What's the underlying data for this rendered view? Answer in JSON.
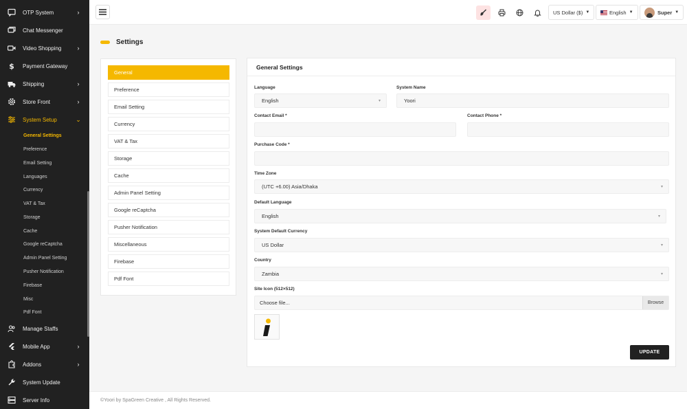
{
  "sidebar": {
    "items": [
      {
        "label": "OTP System",
        "icon": "message-square-icon",
        "chevron": "›"
      },
      {
        "label": "Chat Messenger",
        "icon": "chat-icon",
        "chevron": ""
      },
      {
        "label": "Video Shopping",
        "icon": "video-icon",
        "chevron": "›"
      },
      {
        "label": "Payment Gateway",
        "icon": "dollar-icon",
        "chevron": ""
      },
      {
        "label": "Shipping",
        "icon": "truck-icon",
        "chevron": "›"
      },
      {
        "label": "Store Front",
        "icon": "gear-icon",
        "chevron": "›"
      },
      {
        "label": "System Setup",
        "icon": "sliders-icon",
        "chevron": "⌄"
      }
    ],
    "sub_items": [
      "General Settings",
      "Preference",
      "Email Setting",
      "Languages",
      "Currency",
      "VAT & Tax",
      "Storage",
      "Cache",
      "Google reCaptcha",
      "Admin Panel Setting",
      "Pusher Notification",
      "Firebase",
      "Misc",
      "Pdf Font"
    ],
    "bottom_items": [
      {
        "label": "Manage Staffs",
        "icon": "users-icon",
        "chevron": ""
      },
      {
        "label": "Mobile App",
        "icon": "flutter-icon",
        "chevron": "›"
      },
      {
        "label": "Addons",
        "icon": "puzzle-icon",
        "chevron": "›"
      },
      {
        "label": "System Update",
        "icon": "wrench-icon",
        "chevron": ""
      },
      {
        "label": "Server Info",
        "icon": "server-icon",
        "chevron": ""
      }
    ],
    "active_color": "#f5b800"
  },
  "topbar": {
    "currency": "US Dollar ($)",
    "language": "English",
    "user": "Super",
    "icons": [
      "menu-icon",
      "brush-icon",
      "printer-icon",
      "globe-icon",
      "bell-icon"
    ]
  },
  "page": {
    "title": "Settings"
  },
  "settings_nav": [
    "General",
    "Preference",
    "Email Setting",
    "Currency",
    "VAT & Tax",
    "Storage",
    "Cache",
    "Admin Panel Setting",
    "Google reCaptcha",
    "Pusher Notification",
    "Miscellaneous",
    "Firebase",
    "Pdf Font"
  ],
  "form": {
    "title": "General Settings",
    "language_label": "Language",
    "language_value": "English",
    "system_name_label": "System Name",
    "system_name_value": "Yoori",
    "contact_email_label": "Contact Email *",
    "contact_email_value": "",
    "contact_phone_label": "Contact Phone *",
    "contact_phone_value": "",
    "purchase_code_label": "Purchase Code *",
    "purchase_code_value": "",
    "timezone_label": "Time Zone",
    "timezone_value": "(UTC +6.00) Asia/Dhaka",
    "default_language_label": "Default Language",
    "default_language_value": "English",
    "default_currency_label": "System Default Currency",
    "default_currency_value": "US Dollar",
    "country_label": "Country",
    "country_value": "Zambia",
    "site_icon_label": "Site Icon (512×512)",
    "file_placeholder": "Choose file...",
    "browse_label": "Browse",
    "update_label": "UPDATE"
  },
  "footer": {
    "text": "©Yoori by SpaGreen Creative , All Rights Reserved."
  }
}
